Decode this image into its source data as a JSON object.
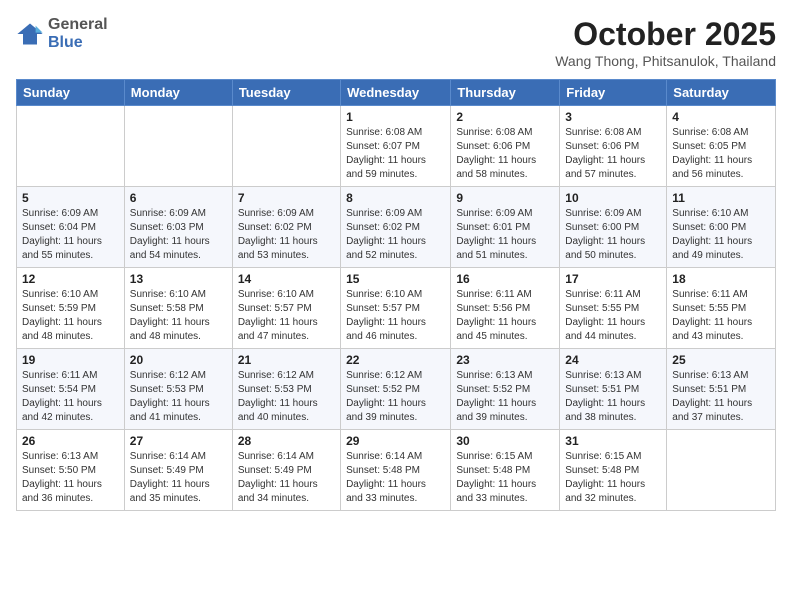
{
  "logo": {
    "general": "General",
    "blue": "Blue"
  },
  "header": {
    "month": "October 2025",
    "location": "Wang Thong, Phitsanulok, Thailand"
  },
  "weekdays": [
    "Sunday",
    "Monday",
    "Tuesday",
    "Wednesday",
    "Thursday",
    "Friday",
    "Saturday"
  ],
  "weeks": [
    [
      {
        "day": "",
        "text": ""
      },
      {
        "day": "",
        "text": ""
      },
      {
        "day": "",
        "text": ""
      },
      {
        "day": "1",
        "text": "Sunrise: 6:08 AM\nSunset: 6:07 PM\nDaylight: 11 hours\nand 59 minutes."
      },
      {
        "day": "2",
        "text": "Sunrise: 6:08 AM\nSunset: 6:06 PM\nDaylight: 11 hours\nand 58 minutes."
      },
      {
        "day": "3",
        "text": "Sunrise: 6:08 AM\nSunset: 6:06 PM\nDaylight: 11 hours\nand 57 minutes."
      },
      {
        "day": "4",
        "text": "Sunrise: 6:08 AM\nSunset: 6:05 PM\nDaylight: 11 hours\nand 56 minutes."
      }
    ],
    [
      {
        "day": "5",
        "text": "Sunrise: 6:09 AM\nSunset: 6:04 PM\nDaylight: 11 hours\nand 55 minutes."
      },
      {
        "day": "6",
        "text": "Sunrise: 6:09 AM\nSunset: 6:03 PM\nDaylight: 11 hours\nand 54 minutes."
      },
      {
        "day": "7",
        "text": "Sunrise: 6:09 AM\nSunset: 6:02 PM\nDaylight: 11 hours\nand 53 minutes."
      },
      {
        "day": "8",
        "text": "Sunrise: 6:09 AM\nSunset: 6:02 PM\nDaylight: 11 hours\nand 52 minutes."
      },
      {
        "day": "9",
        "text": "Sunrise: 6:09 AM\nSunset: 6:01 PM\nDaylight: 11 hours\nand 51 minutes."
      },
      {
        "day": "10",
        "text": "Sunrise: 6:09 AM\nSunset: 6:00 PM\nDaylight: 11 hours\nand 50 minutes."
      },
      {
        "day": "11",
        "text": "Sunrise: 6:10 AM\nSunset: 6:00 PM\nDaylight: 11 hours\nand 49 minutes."
      }
    ],
    [
      {
        "day": "12",
        "text": "Sunrise: 6:10 AM\nSunset: 5:59 PM\nDaylight: 11 hours\nand 48 minutes."
      },
      {
        "day": "13",
        "text": "Sunrise: 6:10 AM\nSunset: 5:58 PM\nDaylight: 11 hours\nand 48 minutes."
      },
      {
        "day": "14",
        "text": "Sunrise: 6:10 AM\nSunset: 5:57 PM\nDaylight: 11 hours\nand 47 minutes."
      },
      {
        "day": "15",
        "text": "Sunrise: 6:10 AM\nSunset: 5:57 PM\nDaylight: 11 hours\nand 46 minutes."
      },
      {
        "day": "16",
        "text": "Sunrise: 6:11 AM\nSunset: 5:56 PM\nDaylight: 11 hours\nand 45 minutes."
      },
      {
        "day": "17",
        "text": "Sunrise: 6:11 AM\nSunset: 5:55 PM\nDaylight: 11 hours\nand 44 minutes."
      },
      {
        "day": "18",
        "text": "Sunrise: 6:11 AM\nSunset: 5:55 PM\nDaylight: 11 hours\nand 43 minutes."
      }
    ],
    [
      {
        "day": "19",
        "text": "Sunrise: 6:11 AM\nSunset: 5:54 PM\nDaylight: 11 hours\nand 42 minutes."
      },
      {
        "day": "20",
        "text": "Sunrise: 6:12 AM\nSunset: 5:53 PM\nDaylight: 11 hours\nand 41 minutes."
      },
      {
        "day": "21",
        "text": "Sunrise: 6:12 AM\nSunset: 5:53 PM\nDaylight: 11 hours\nand 40 minutes."
      },
      {
        "day": "22",
        "text": "Sunrise: 6:12 AM\nSunset: 5:52 PM\nDaylight: 11 hours\nand 39 minutes."
      },
      {
        "day": "23",
        "text": "Sunrise: 6:13 AM\nSunset: 5:52 PM\nDaylight: 11 hours\nand 39 minutes."
      },
      {
        "day": "24",
        "text": "Sunrise: 6:13 AM\nSunset: 5:51 PM\nDaylight: 11 hours\nand 38 minutes."
      },
      {
        "day": "25",
        "text": "Sunrise: 6:13 AM\nSunset: 5:51 PM\nDaylight: 11 hours\nand 37 minutes."
      }
    ],
    [
      {
        "day": "26",
        "text": "Sunrise: 6:13 AM\nSunset: 5:50 PM\nDaylight: 11 hours\nand 36 minutes."
      },
      {
        "day": "27",
        "text": "Sunrise: 6:14 AM\nSunset: 5:49 PM\nDaylight: 11 hours\nand 35 minutes."
      },
      {
        "day": "28",
        "text": "Sunrise: 6:14 AM\nSunset: 5:49 PM\nDaylight: 11 hours\nand 34 minutes."
      },
      {
        "day": "29",
        "text": "Sunrise: 6:14 AM\nSunset: 5:48 PM\nDaylight: 11 hours\nand 33 minutes."
      },
      {
        "day": "30",
        "text": "Sunrise: 6:15 AM\nSunset: 5:48 PM\nDaylight: 11 hours\nand 33 minutes."
      },
      {
        "day": "31",
        "text": "Sunrise: 6:15 AM\nSunset: 5:48 PM\nDaylight: 11 hours\nand 32 minutes."
      },
      {
        "day": "",
        "text": ""
      }
    ]
  ]
}
